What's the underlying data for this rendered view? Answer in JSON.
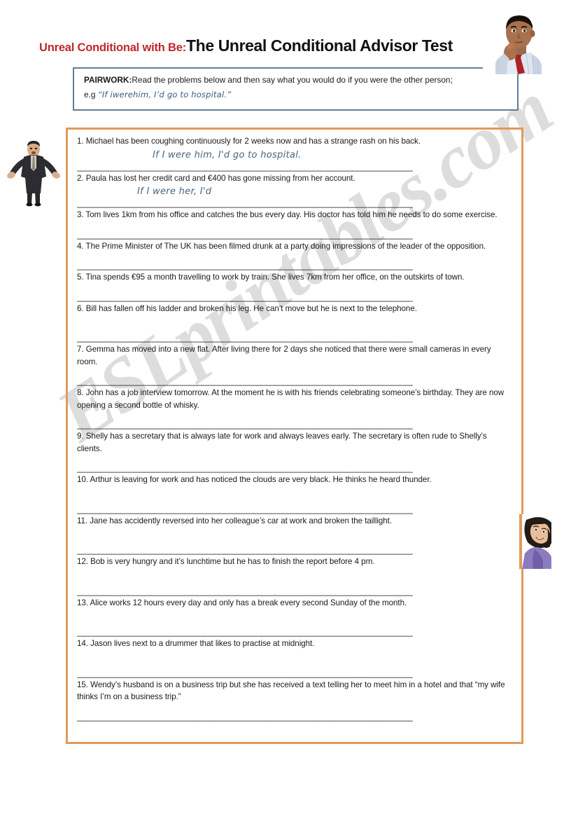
{
  "header": {
    "title_prefix": "Unreal Conditional with Be:",
    "title_main": "The Unreal Conditional Advisor Test"
  },
  "instructions": {
    "label": "PAIRWORK:",
    "body": "Read the problems below and then say what you would do if you were the other person;",
    "example_prefix": "e.g ",
    "example_text": "“If iwerehim, I’d go to hospital.”"
  },
  "watermark": {
    "text": "ESLprintables.com"
  },
  "colors": {
    "title_prefix_red": "#c0272d",
    "title_main_black": "#111111",
    "instruction_border_blue": "#5d7e99",
    "exercise_border_orange": "#e09a5c",
    "handwriting_blue": "#48657f",
    "watermark_gray": "#c9c9c9",
    "body_text": "#1a1a1a",
    "page_background": "#ffffff"
  },
  "layout": {
    "blank_line": "______________________________________________________________________________"
  },
  "exercises": [
    {
      "number": "1.",
      "prompt": "1. Michael has been coughing continuously for 2 weeks now and has a strange rash on his back.",
      "answer": "If I were him, I'd go to hospital."
    },
    {
      "number": "2.",
      "prompt": "2. Paula has lost her credit card and €400 has gone missing from her account.",
      "answer": "If I were her, I'd"
    },
    {
      "number": "3.",
      "prompt": "3. Tom lives 1km from his office and catches the bus every day. His doctor has told him he needs to do some exercise.",
      "answer": ""
    },
    {
      "number": "4.",
      "prompt": "4. The Prime Minister of The UK has been filmed drunk at a party doing impressions of the leader of the opposition.",
      "answer": ""
    },
    {
      "number": "5.",
      "prompt": "5. Tina spends €95 a month travelling to work by train. She lives 7km from her office, on the outskirts of town.",
      "answer": ""
    },
    {
      "number": "6.",
      "prompt": "6. Bill has fallen off his ladder and broken his leg. He can’t move but he is next to the telephone.",
      "answer": ""
    },
    {
      "number": "7.",
      "prompt": "7. Gemma has moved into a new flat. After living there for 2 days she noticed that there were small cameras in every room.",
      "answer": ""
    },
    {
      "number": "8.",
      "prompt": "8. John has a job interview tomorrow. At the moment he is with his friends celebrating someone’s birthday. They are now opening a second bottle of whisky.",
      "answer": ""
    },
    {
      "number": "9.",
      "prompt": "9. Shelly has a secretary that is always late for work and always leaves early. The secretary is often rude to Shelly’s clients.",
      "answer": ""
    },
    {
      "number": "10.",
      "prompt": "10. Arthur is leaving for work and has noticed the clouds are very black. He thinks he heard thunder.",
      "answer": ""
    },
    {
      "number": "11.",
      "prompt": "11. Jane has accidently reversed into her colleague’s car at work and broken the taillight.",
      "answer": ""
    },
    {
      "number": "12.",
      "prompt": "12. Bob is very hungry and it’s lunchtime but he has to finish the report before 4 pm.",
      "answer": ""
    },
    {
      "number": "13.",
      "prompt": "13. Alice works 12 hours every day and only has a break every second Sunday of the month.",
      "answer": ""
    },
    {
      "number": "14.",
      "prompt": "14. Jason lives next to a drummer that likes to practise at midnight.",
      "answer": ""
    },
    {
      "number": "15.",
      "prompt": "15. Wendy’s husband is on a business trip but she has received a text telling her to meet him in a hotel and that “my wife thinks I’m on a business trip.”",
      "answer": ""
    }
  ]
}
